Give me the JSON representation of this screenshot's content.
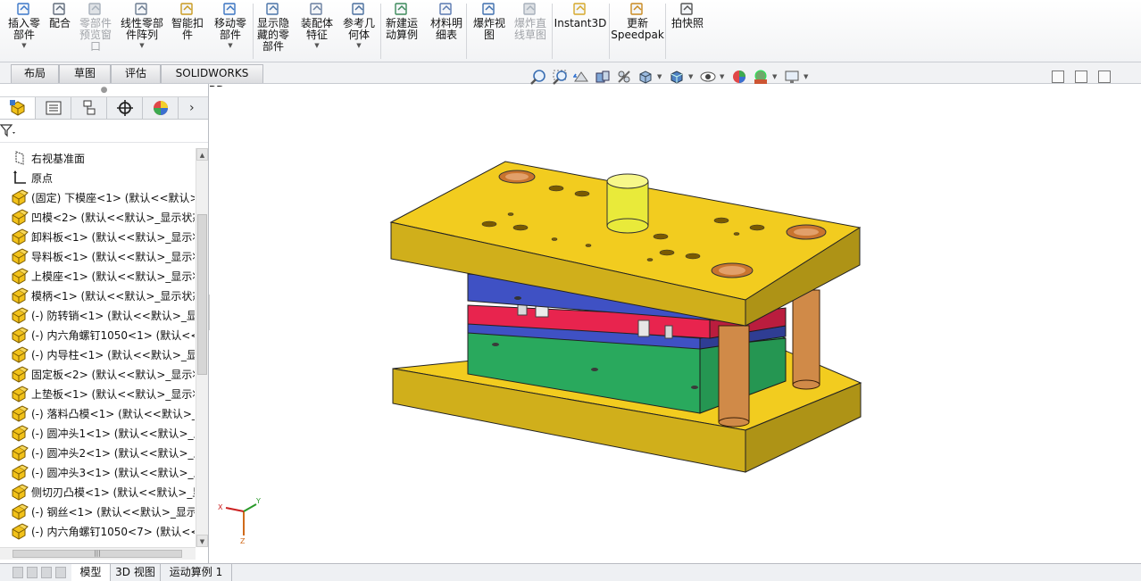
{
  "ribbon": {
    "buttons": [
      {
        "id": "insert-component",
        "label": "插入零\n部件",
        "icon": "insert-component-icon",
        "dropdown": true,
        "disabled": false
      },
      {
        "id": "mate",
        "label": "配合",
        "icon": "mate-icon",
        "dropdown": false,
        "disabled": false
      },
      {
        "id": "component-preview",
        "label": "零部件\n预览窗\n口",
        "icon": "preview-window-icon",
        "dropdown": false,
        "disabled": true
      },
      {
        "id": "linear-pattern",
        "label": "线性零部\n件阵列",
        "icon": "linear-pattern-icon",
        "dropdown": true,
        "disabled": false
      },
      {
        "id": "smart-fasteners",
        "label": "智能扣\n件",
        "icon": "smart-fastener-icon",
        "dropdown": false,
        "disabled": false
      },
      {
        "id": "move-component",
        "label": "移动零\n部件",
        "icon": "move-component-icon",
        "dropdown": true,
        "disabled": false
      },
      {
        "id": "show-hidden",
        "label": "显示隐\n藏的零\n部件",
        "icon": "show-hidden-icon",
        "dropdown": false,
        "disabled": false
      },
      {
        "id": "assembly-features",
        "label": "装配体\n特征",
        "icon": "assembly-feature-icon",
        "dropdown": true,
        "disabled": false
      },
      {
        "id": "reference-geometry",
        "label": "参考几\n何体",
        "icon": "reference-geometry-icon",
        "dropdown": true,
        "disabled": false
      },
      {
        "id": "new-motion-study",
        "label": "新建运\n动算例",
        "icon": "motion-study-icon",
        "dropdown": false,
        "disabled": false
      },
      {
        "id": "bill-of-materials",
        "label": "材料明\n细表",
        "icon": "bom-icon",
        "dropdown": false,
        "disabled": false
      },
      {
        "id": "exploded-view",
        "label": "爆炸视\n图",
        "icon": "exploded-view-icon",
        "dropdown": false,
        "disabled": false
      },
      {
        "id": "explode-line",
        "label": "爆炸直\n线草图",
        "icon": "explode-line-icon",
        "dropdown": false,
        "disabled": true
      },
      {
        "id": "instant3d",
        "label": "Instant3D",
        "icon": "instant3d-icon",
        "dropdown": false,
        "disabled": false
      },
      {
        "id": "update-speedpak",
        "label": "更新\nSpeedpak",
        "icon": "speedpak-icon",
        "dropdown": false,
        "disabled": false
      },
      {
        "id": "take-snapshot",
        "label": "拍快照",
        "icon": "camera-icon",
        "dropdown": false,
        "disabled": false
      }
    ]
  },
  "command_tabs": [
    "布局",
    "草图",
    "评估",
    "SOLIDWORKS MBD"
  ],
  "feature_tree": {
    "items": [
      {
        "label": "右视基准面",
        "icon": "plane-icon"
      },
      {
        "label": "原点",
        "icon": "origin-icon"
      },
      {
        "label": "(固定) 下模座<1> (默认<<默认>_",
        "icon": "part-icon"
      },
      {
        "label": "凹模<2> (默认<<默认>_显示状态",
        "icon": "part-icon"
      },
      {
        "label": "卸料板<1> (默认<<默认>_显示状",
        "icon": "part-icon"
      },
      {
        "label": "导料板<1> (默认<<默认>_显示状",
        "icon": "part-icon"
      },
      {
        "label": "上模座<1> (默认<<默认>_显示状",
        "icon": "part-icon"
      },
      {
        "label": "模柄<1> (默认<<默认>_显示状态",
        "icon": "part-icon"
      },
      {
        "label": "(-) 防转销<1> (默认<<默认>_显示",
        "icon": "part-icon"
      },
      {
        "label": "(-) 内六角螺钉1050<1> (默认<<默",
        "icon": "part-icon"
      },
      {
        "label": "(-) 内导柱<1> (默认<<默认>_显示",
        "icon": "part-icon"
      },
      {
        "label": "固定板<2> (默认<<默认>_显示状",
        "icon": "part-icon"
      },
      {
        "label": "上垫板<1> (默认<<默认>_显示状",
        "icon": "part-icon"
      },
      {
        "label": "(-) 落料凸模<1> (默认<<默认>_显",
        "icon": "part-icon"
      },
      {
        "label": "(-) 圆冲头1<1> (默认<<默认>_显",
        "icon": "part-icon"
      },
      {
        "label": "(-) 圆冲头2<1> (默认<<默认>_显",
        "icon": "part-icon"
      },
      {
        "label": "(-) 圆冲头3<1> (默认<<默认>_显",
        "icon": "part-icon"
      },
      {
        "label": "侧切刃凸模<1> (默认<<默认>_显",
        "icon": "part-icon"
      },
      {
        "label": "(-) 钢丝<1> (默认<<默认>_显示状",
        "icon": "part-icon"
      },
      {
        "label": "(-) 内六角螺钉1050<7> (默认<<默",
        "icon": "part-icon"
      }
    ]
  },
  "triad": {
    "x": "X",
    "y": "Y",
    "z": "Z"
  },
  "bottom_tabs": [
    "模型",
    "3D 视图",
    "运动算例 1"
  ],
  "colors": {
    "die_base": "#f2cc1f",
    "plate_blue": "#3f51c4",
    "plate_red": "#e8244e",
    "die_green": "#2ebc67",
    "guide_post": "#d08a48",
    "shank": "#e9ea3a"
  }
}
